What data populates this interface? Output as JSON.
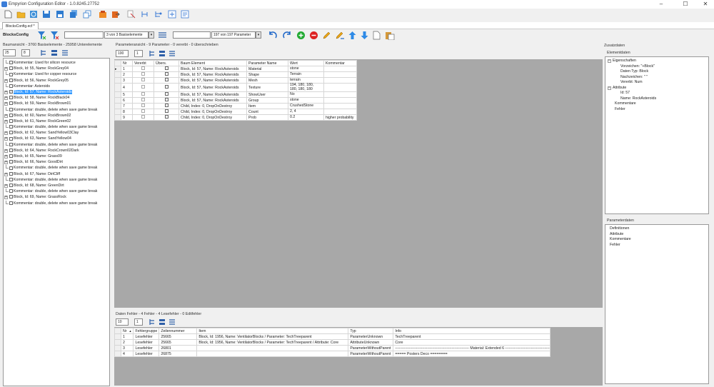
{
  "window": {
    "title": "Empyrion Configuration Editor - 1.0.8245.27752",
    "minimize": "–",
    "maximize": "☐",
    "close": "✕"
  },
  "toolbar_icons": [
    "new-file-icon",
    "open-folder-icon",
    "reload-icon",
    "save-icon",
    "save-as-icon",
    "save-all-icon",
    "copy-icon",
    "export-icon",
    "compare-icon",
    "cut-icon",
    "settings-icon",
    "help-icon"
  ],
  "tab": {
    "label": "BlocksConfig.ecf *"
  },
  "toolbar2": {
    "file_label": "BlocksConfig",
    "filter_value": "",
    "filter_count": "3 von 3 Basiselemente",
    "param_filter_value": "",
    "param_count": "197 von 197 Parameter"
  },
  "tree": {
    "header": "Baumansicht - 3760 Basiselemente - 25958 Unterelemente",
    "page_size": "25",
    "depth": "8",
    "rows": [
      {
        "text": "Kommentar: Used for silicon resource",
        "exp": false,
        "check": false
      },
      {
        "text": "Block, Id: 55, Name: RockGrey04",
        "exp": true,
        "check": true
      },
      {
        "text": "Kommentar: Used for copper resource",
        "exp": false,
        "check": false
      },
      {
        "text": "Block, Id: 56, Name: RockGrey05",
        "exp": true,
        "check": true
      },
      {
        "text": "Kommentar: Asteroids",
        "exp": false,
        "check": false
      },
      {
        "text": "Block, Id: 57, Name: RockAsteroids",
        "exp": true,
        "check": true,
        "selected": true
      },
      {
        "text": "Block, Id: 58, Name: RockBlack04",
        "exp": true,
        "check": true
      },
      {
        "text": "Block, Id: 59, Name: RockBrown01",
        "exp": true,
        "check": true
      },
      {
        "text": "Kommentar: double, delete when save game break",
        "exp": false,
        "check": false
      },
      {
        "text": "Block, Id: 60, Name: RockBrown02",
        "exp": true,
        "check": true
      },
      {
        "text": "Block, Id: 61, Name: RockGreen02",
        "exp": true,
        "check": true
      },
      {
        "text": "Kommentar: double, delete when save game break",
        "exp": false,
        "check": false
      },
      {
        "text": "Block, Id: 62, Name: SandYellow03Clay",
        "exp": true,
        "check": true
      },
      {
        "text": "Block, Id: 63, Name: SandYellow04",
        "exp": true,
        "check": true
      },
      {
        "text": "Kommentar: double, delete when save game break",
        "exp": false,
        "check": false
      },
      {
        "text": "Block, Id: 64, Name: RockCrown02Dark",
        "exp": true,
        "check": true
      },
      {
        "text": "Block, Id: 65, Name: Grass09",
        "exp": true,
        "check": true
      },
      {
        "text": "Block, Id: 66, Name: GoodDirt",
        "exp": true,
        "check": true
      },
      {
        "text": "Kommentar: double, delete when save game break",
        "exp": false,
        "check": false
      },
      {
        "text": "Block, Id: 67, Name: DirtCliff",
        "exp": true,
        "check": true
      },
      {
        "text": "Kommentar: double, delete when save game break",
        "exp": false,
        "check": false
      },
      {
        "text": "Block, Id: 68, Name: GreenDirt",
        "exp": true,
        "check": true
      },
      {
        "text": "Kommentar: double, delete when save game break",
        "exp": false,
        "check": false
      },
      {
        "text": "Block, Id: 69, Name: GrassRock",
        "exp": true,
        "check": true
      },
      {
        "text": "Kommentar: double, delete when save game break",
        "exp": false,
        "check": false
      }
    ]
  },
  "params": {
    "header": "Parameteransicht - 9 Parameter - 0 vererbt - 0 überschrieben",
    "page_size": "100",
    "depth": "1",
    "columns": [
      "Nr",
      "Vererbt",
      "Übers.",
      "Baum Element",
      "Parameter Name",
      "Wert",
      "Kommentar"
    ],
    "rows": [
      {
        "nr": "1",
        "elem": "Block, Id: 57, Name: RockAsteroids",
        "name": "Material",
        "value": "stone",
        "comment": ""
      },
      {
        "nr": "2",
        "elem": "Block, Id: 57, Name: RockAsteroids",
        "name": "Shape",
        "value": "Terrain",
        "comment": ""
      },
      {
        "nr": "3",
        "elem": "Block, Id: 57, Name: RockAsteroids",
        "name": "Mesh",
        "value": "terrain",
        "comment": ""
      },
      {
        "nr": "4",
        "elem": "Block, Id: 57, Name: RockAsteroids",
        "name": "Texture",
        "value": "194, 180, 180,\n180, 180, 180",
        "comment": ""
      },
      {
        "nr": "5",
        "elem": "Block, Id: 57, Name: RockAsteroids",
        "name": "ShowUser",
        "value": "No",
        "comment": ""
      },
      {
        "nr": "6",
        "elem": "Block, Id: 57, Name: RockAsteroids",
        "name": "Group",
        "value": "stone",
        "comment": ""
      },
      {
        "nr": "7",
        "elem": "Child, Index: 0, DropOnDestroy",
        "name": "Item",
        "value": "CrushedStone",
        "comment": ""
      },
      {
        "nr": "8",
        "elem": "Child, Index: 0, DropOnDestroy",
        "name": "Count",
        "value": "2, 4",
        "comment": ""
      },
      {
        "nr": "9",
        "elem": "Child, Index: 0, DropOnDestroy",
        "name": "Prob",
        "value": "0.2",
        "comment": "higher probability"
      }
    ]
  },
  "errors": {
    "header": "Daten Fehler - 4 Fehler - 4 Lesefehler - 0 Editfehler",
    "page_size": "10",
    "depth": "1",
    "columns": [
      "Nr",
      "Fehlergruppe",
      "Zeilennummer",
      "Item",
      "Typ",
      "Info"
    ],
    "sort_arrow": "▲",
    "rows": [
      {
        "nr": "1",
        "group": "Lesefehler",
        "line": "25665",
        "item": "Block, Id: 1956, Name: VentilatorBlocks / Parameter: TechTreeparent",
        "type": "ParameterUnknown",
        "info": "TechTreeparent"
      },
      {
        "nr": "2",
        "group": "Lesefehler",
        "line": "25665",
        "item": "Block, Id: 1956, Name: VentilatorBlocks / Parameter: TechTreeparent / Attribute: Core",
        "type": "AttributeUnknown",
        "info": "Core"
      },
      {
        "nr": "3",
        "group": "Lesefehler",
        "line": "26801",
        "item": "",
        "type": "ParameterWithoutParent",
        "info": "------------------------------------------------------------ Material: Extended 6 ------------------------------------------------------------"
      },
      {
        "nr": "4",
        "group": "Lesefehler",
        "line": "26875",
        "item": "",
        "type": "ParameterWithoutParent",
        "info": "=====   Posters Deco ========"
      }
    ]
  },
  "zusatz": {
    "header": "Zusatzdaten",
    "elem_header": "Elementdaten",
    "elem_tree": [
      {
        "text": "Eigenschaften",
        "level": 0,
        "exp": "−"
      },
      {
        "text": "Vorzeichen: \"+Block\"",
        "level": 2
      },
      {
        "text": "Daten Typ: Block",
        "level": 2
      },
      {
        "text": "Nachzeichen: \" \"",
        "level": 2
      },
      {
        "text": "Vererbt: Num",
        "level": 2
      },
      {
        "text": "Attribute",
        "level": 0,
        "exp": "−"
      },
      {
        "text": "Id: 57",
        "level": 2
      },
      {
        "text": "Name: RockAsteroids",
        "level": 2
      },
      {
        "text": "Kommentare",
        "level": 1
      },
      {
        "text": "Fehler",
        "level": 1
      }
    ],
    "param_header": "Parameterdaten",
    "param_tree": [
      {
        "text": "Definitionen"
      },
      {
        "text": "Attribute"
      },
      {
        "text": "Kommentare"
      },
      {
        "text": "Fehler"
      }
    ]
  },
  "colors": {
    "selection": "#3399ff",
    "workspace": "#a8a8a8",
    "green": "#22aa33",
    "red": "#dd2222",
    "blue": "#2277dd",
    "orange": "#e8a317"
  }
}
